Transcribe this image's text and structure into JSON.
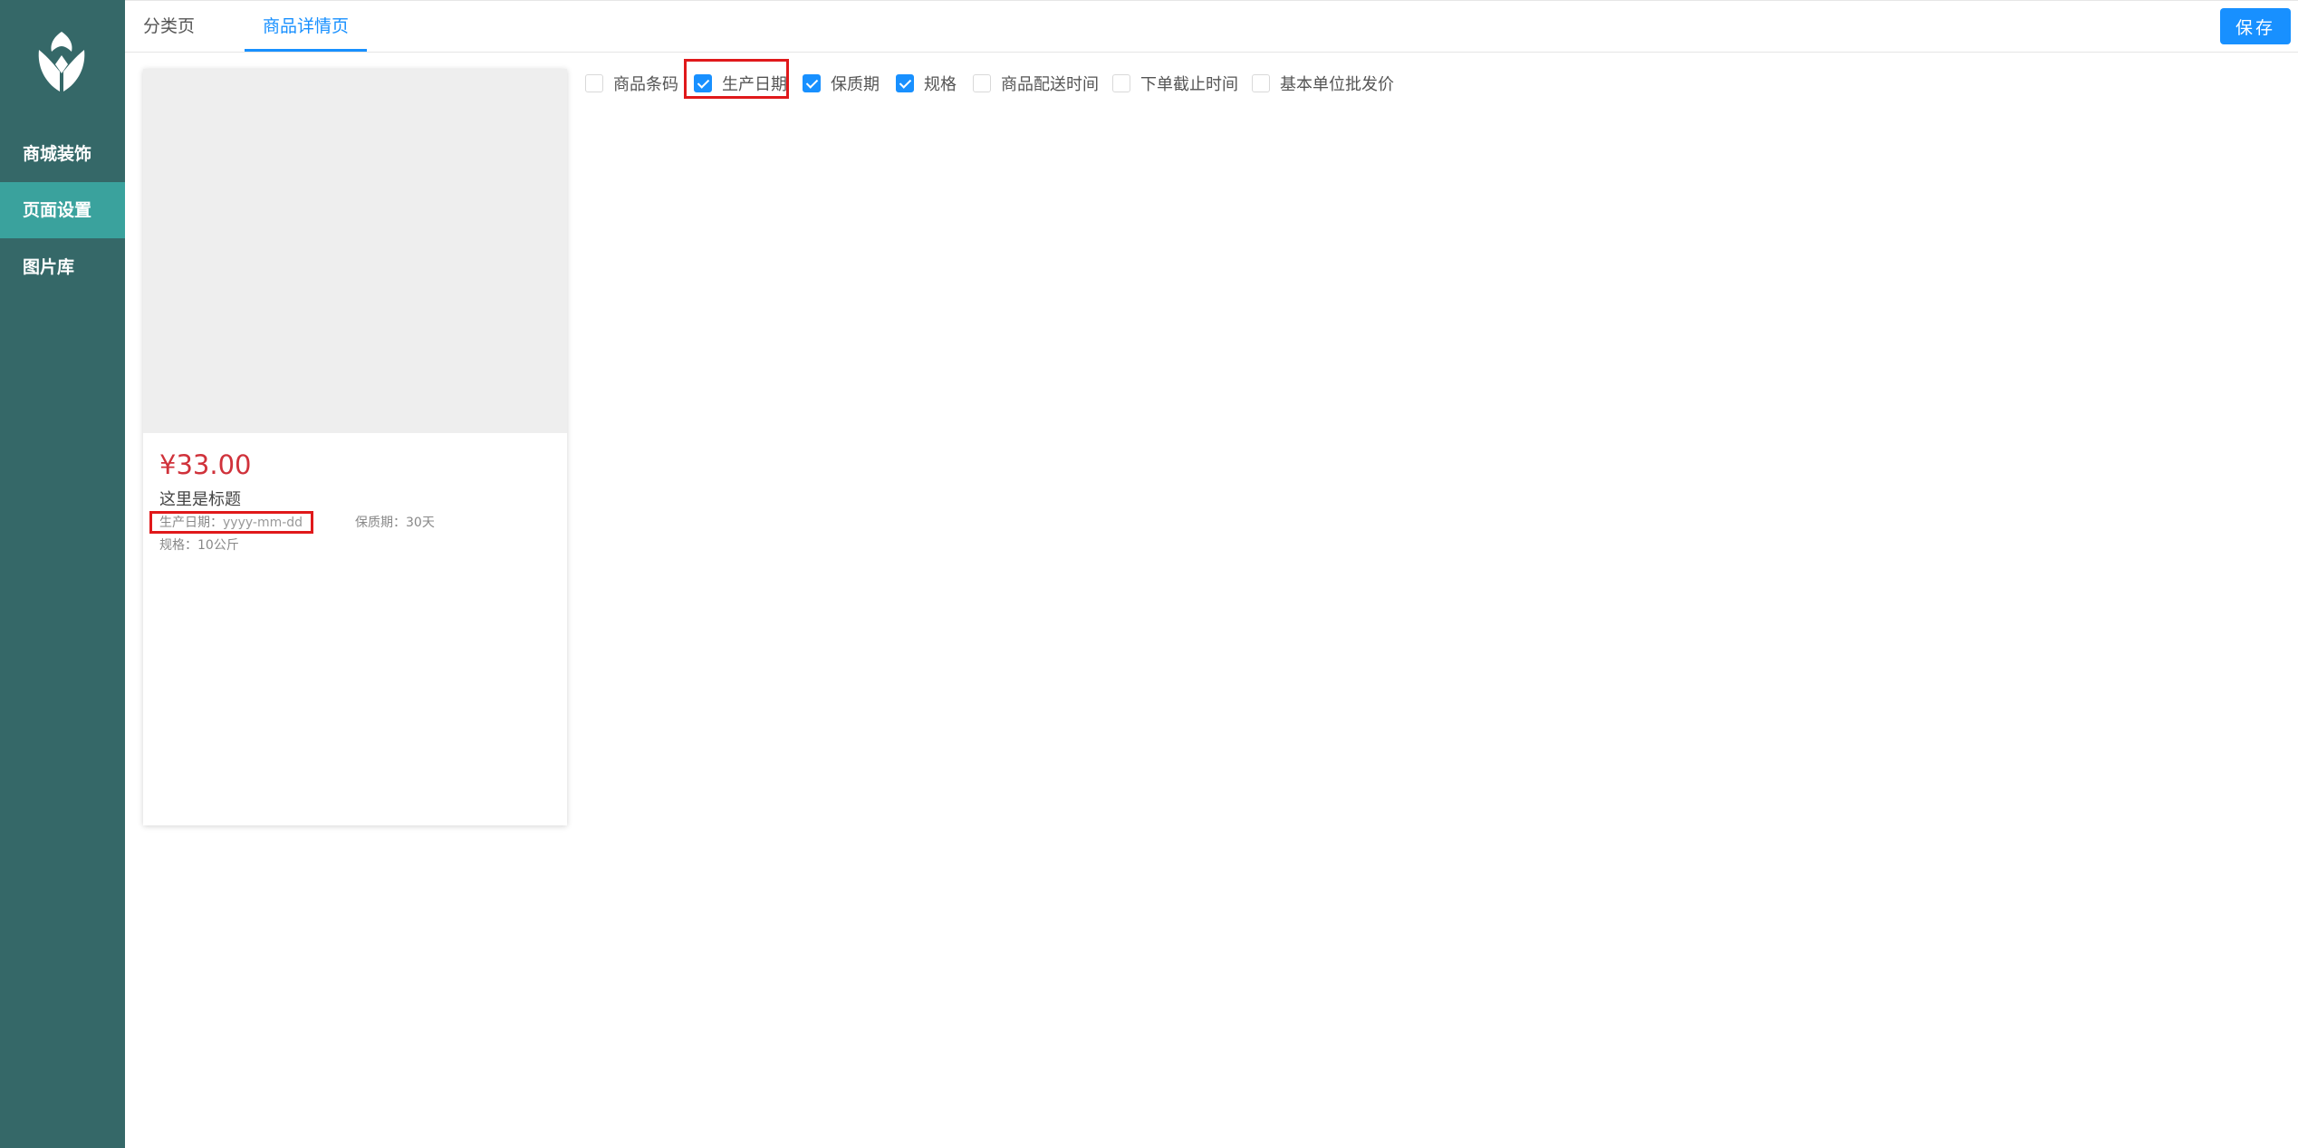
{
  "sidebar": {
    "logo": "leaf-logo-icon",
    "items": [
      {
        "label": "商城装饰"
      },
      {
        "label": "页面设置"
      },
      {
        "label": "图片库"
      }
    ],
    "active_index": 1,
    "bg_color": "#356868",
    "active_color": "#3aa29d"
  },
  "tabs": [
    {
      "label": "分类页"
    },
    {
      "label": "商品详情页"
    }
  ],
  "active_tab": 1,
  "save_label": "保存",
  "card": {
    "price": "¥33.00",
    "title": "这里是标题",
    "production_date_label": "生产日期：",
    "production_date_value": "yyyy-mm-dd",
    "shelf_life": "保质期：30天",
    "spec": "规格：10公斤"
  },
  "options": [
    {
      "label": "商品条码",
      "checked": false
    },
    {
      "label": "生产日期",
      "checked": true
    },
    {
      "label": "保质期",
      "checked": true
    },
    {
      "label": "规格",
      "checked": true
    },
    {
      "label": "商品配送时间",
      "checked": false
    },
    {
      "label": "下单截止时间",
      "checked": false
    },
    {
      "label": "基本单位批发价",
      "checked": false
    }
  ],
  "colors": {
    "accent": "#1890ff",
    "price": "#d0323b",
    "highlight": "#e0191b"
  }
}
